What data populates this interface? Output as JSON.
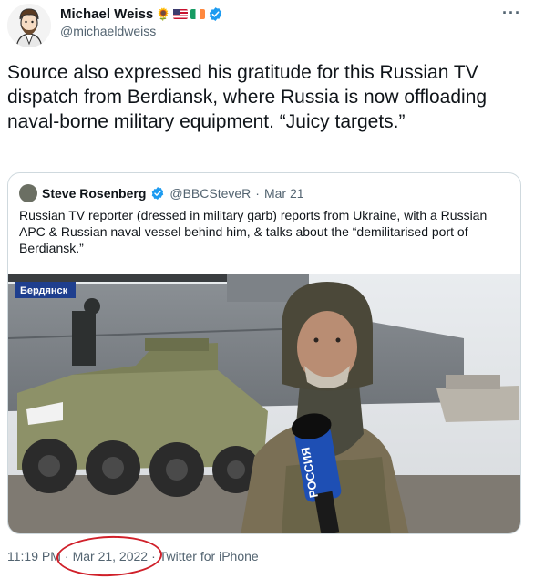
{
  "author": {
    "display_name": "Michael Weiss",
    "handle": "@michaeldweiss",
    "badges": [
      "sunflower-emoji",
      "us-flag",
      "ireland-flag",
      "verified-badge"
    ]
  },
  "tweet": {
    "text": "Source also expressed his gratitude for this Russian TV dispatch from Berdiansk, where Russia is now offloading naval-borne military equipment. “Juicy targets.”"
  },
  "quoted_tweet": {
    "name": "Steve Rosenberg",
    "handle": "@BBCSteveR",
    "separator": "·",
    "date": "Mar 21",
    "text": "Russian TV reporter (dressed in military garb) reports from Ukraine, with a Russian APC & Russian naval vessel behind him, & talks about the “demilitarised port of Berdiansk.”",
    "media": {
      "location_caption": "Бердянск",
      "mic_label": "РОССИЯ"
    }
  },
  "footer": {
    "time": "11:19 PM",
    "separator": "·",
    "date": "Mar 21, 2022",
    "source": "Twitter for iPhone"
  },
  "colors": {
    "verified": "#1d9bf0",
    "text_primary": "#0f1419",
    "text_secondary": "#536471",
    "border": "#cfd9de",
    "annotation_circle": "#d0202a"
  }
}
